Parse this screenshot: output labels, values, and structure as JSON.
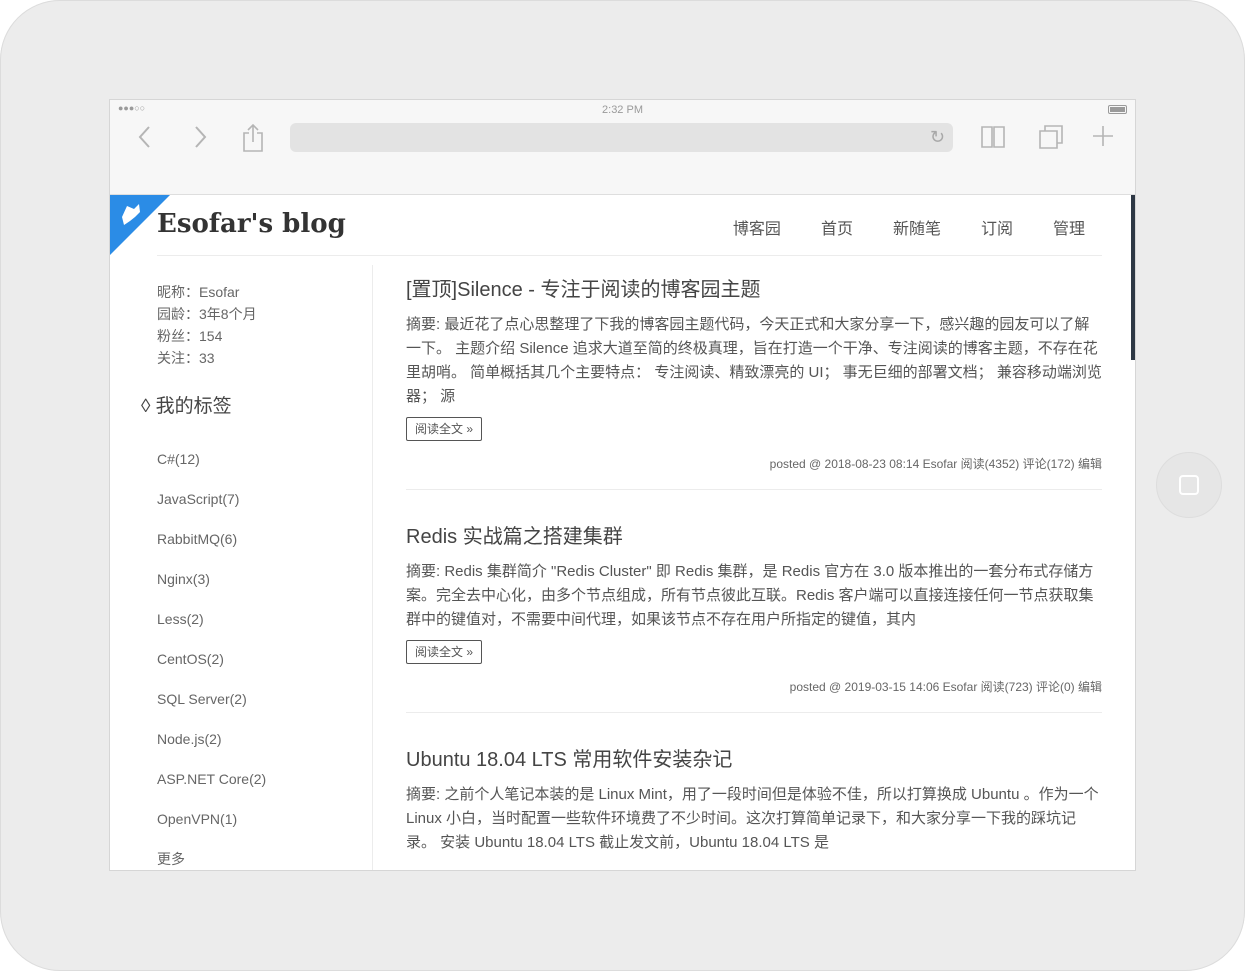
{
  "status_bar": {
    "signal": "●●●○○",
    "time": "2:32 PM"
  },
  "blog": {
    "title": "Esofar's blog"
  },
  "nav": [
    "博客园",
    "首页",
    "新随笔",
    "订阅",
    "管理"
  ],
  "profile": [
    {
      "label": "昵称：",
      "value": "Esofar"
    },
    {
      "label": "园龄：",
      "value": "3年8个月"
    },
    {
      "label": "粉丝：",
      "value": "154"
    },
    {
      "label": "关注：",
      "value": "33"
    }
  ],
  "tags": {
    "title": "◊ 我的标签",
    "items": [
      "C#(12)",
      "JavaScript(7)",
      "RabbitMQ(6)",
      "Nginx(3)",
      "Less(2)",
      "CentOS(2)",
      "SQL Server(2)",
      "Node.js(2)",
      "ASP.NET Core(2)",
      "OpenVPN(1)",
      "更多"
    ]
  },
  "posts": [
    {
      "title": "[置顶]Silence - 专注于阅读的博客园主题",
      "summary": "摘要: 最近花了点心思整理了下我的博客园主题代码，今天正式和大家分享一下，感兴趣的园友可以了解一下。 主题介绍 Silence 追求大道至简的终极真理，旨在打造一个干净、专注阅读的博客主题，不存在花里胡哨。 简单概括其几个主要特点： 专注阅读、精致漂亮的 UI； 事无巨细的部署文档； 兼容移动端浏览器； 源",
      "read_more": "阅读全文 »",
      "meta": "posted @ 2018-08-23 08:14 Esofar 阅读(4352) 评论(172) 编辑"
    },
    {
      "title": "Redis 实战篇之搭建集群",
      "summary": "摘要: Redis 集群简介 \"Redis Cluster\" 即 Redis 集群，是 Redis 官方在 3.0 版本推出的一套分布式存储方案。完全去中心化，由多个节点组成，所有节点彼此互联。Redis 客户端可以直接连接任何一节点获取集群中的键值对，不需要中间代理，如果该节点不存在用户所指定的键值，其内",
      "read_more": "阅读全文 »",
      "meta": "posted @ 2019-03-15 14:06 Esofar 阅读(723) 评论(0) 编辑"
    },
    {
      "title": "Ubuntu 18.04 LTS 常用软件安装杂记",
      "summary": "摘要: 之前个人笔记本装的是 Linux Mint，用了一段时间但是体验不佳，所以打算换成 Ubuntu 。作为一个 Linux 小白，当时配置一些软件环境费了不少时间。这次打算简单记录下，和大家分享一下我的踩坑记录。 安装 Ubuntu 18.04 LTS 截止发文前，Ubuntu 18.04 LTS 是"
    }
  ],
  "colors": {
    "accent": "#2b8ce6",
    "scroll_thumb": "#2e3845"
  }
}
